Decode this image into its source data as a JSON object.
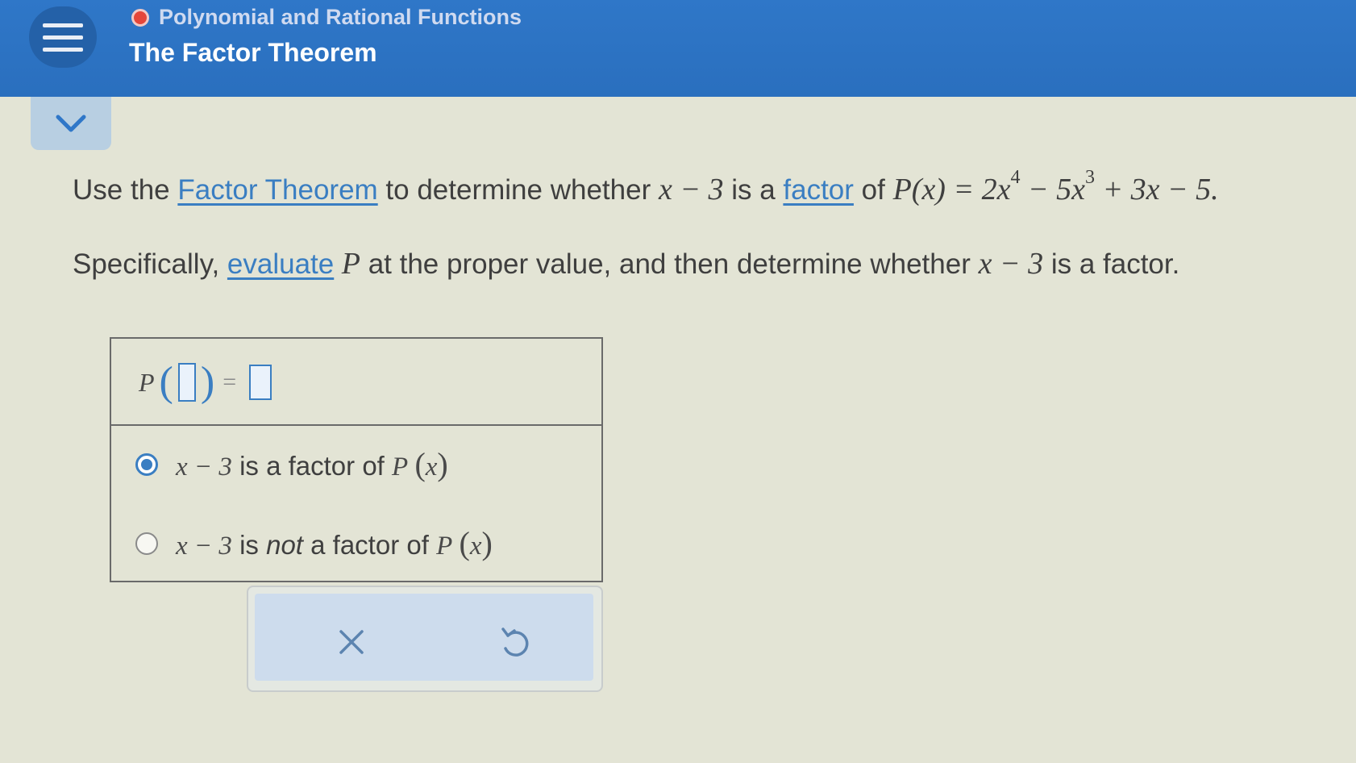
{
  "header": {
    "topic": "Polynomial and Rational Functions",
    "lesson": "The Factor Theorem"
  },
  "question": {
    "line1_pre": "Use the ",
    "line1_link1": "Factor Theorem",
    "line1_mid1": " to determine whether ",
    "line1_expr1": "x − 3",
    "line1_mid2": " is a ",
    "line1_link2": "factor",
    "line1_mid3": " of ",
    "line1_poly": "P(x) = 2x",
    "line1_exp4": "4",
    "line1_poly2": " − 5x",
    "line1_exp3": "3",
    "line1_poly3": " + 3x − 5.",
    "line2_pre": "Specifically, ",
    "line2_link": "evaluate",
    "line2_var": " P",
    "line2_mid": " at the proper value, and then determine whether ",
    "line2_expr": "x − 3",
    "line2_post": " is a factor."
  },
  "answer": {
    "eval_label": "P",
    "eval_equals": "=",
    "option1_expr": "x − 3",
    "option1_text": " is a factor of ",
    "option1_func": "P",
    "option1_var": "x",
    "option2_expr": "x − 3",
    "option2_is": " is ",
    "option2_not": "not",
    "option2_text": " a factor of ",
    "option2_func": "P",
    "option2_var": "x",
    "selected_option": 1
  },
  "colors": {
    "header": "#2f77c8",
    "accent": "#3a7ec2",
    "topic_dot": "#e4463a"
  },
  "icons": {
    "menu": "hamburger-icon",
    "collapse": "chevron-down-icon",
    "clear": "close-icon",
    "undo": "undo-icon"
  }
}
